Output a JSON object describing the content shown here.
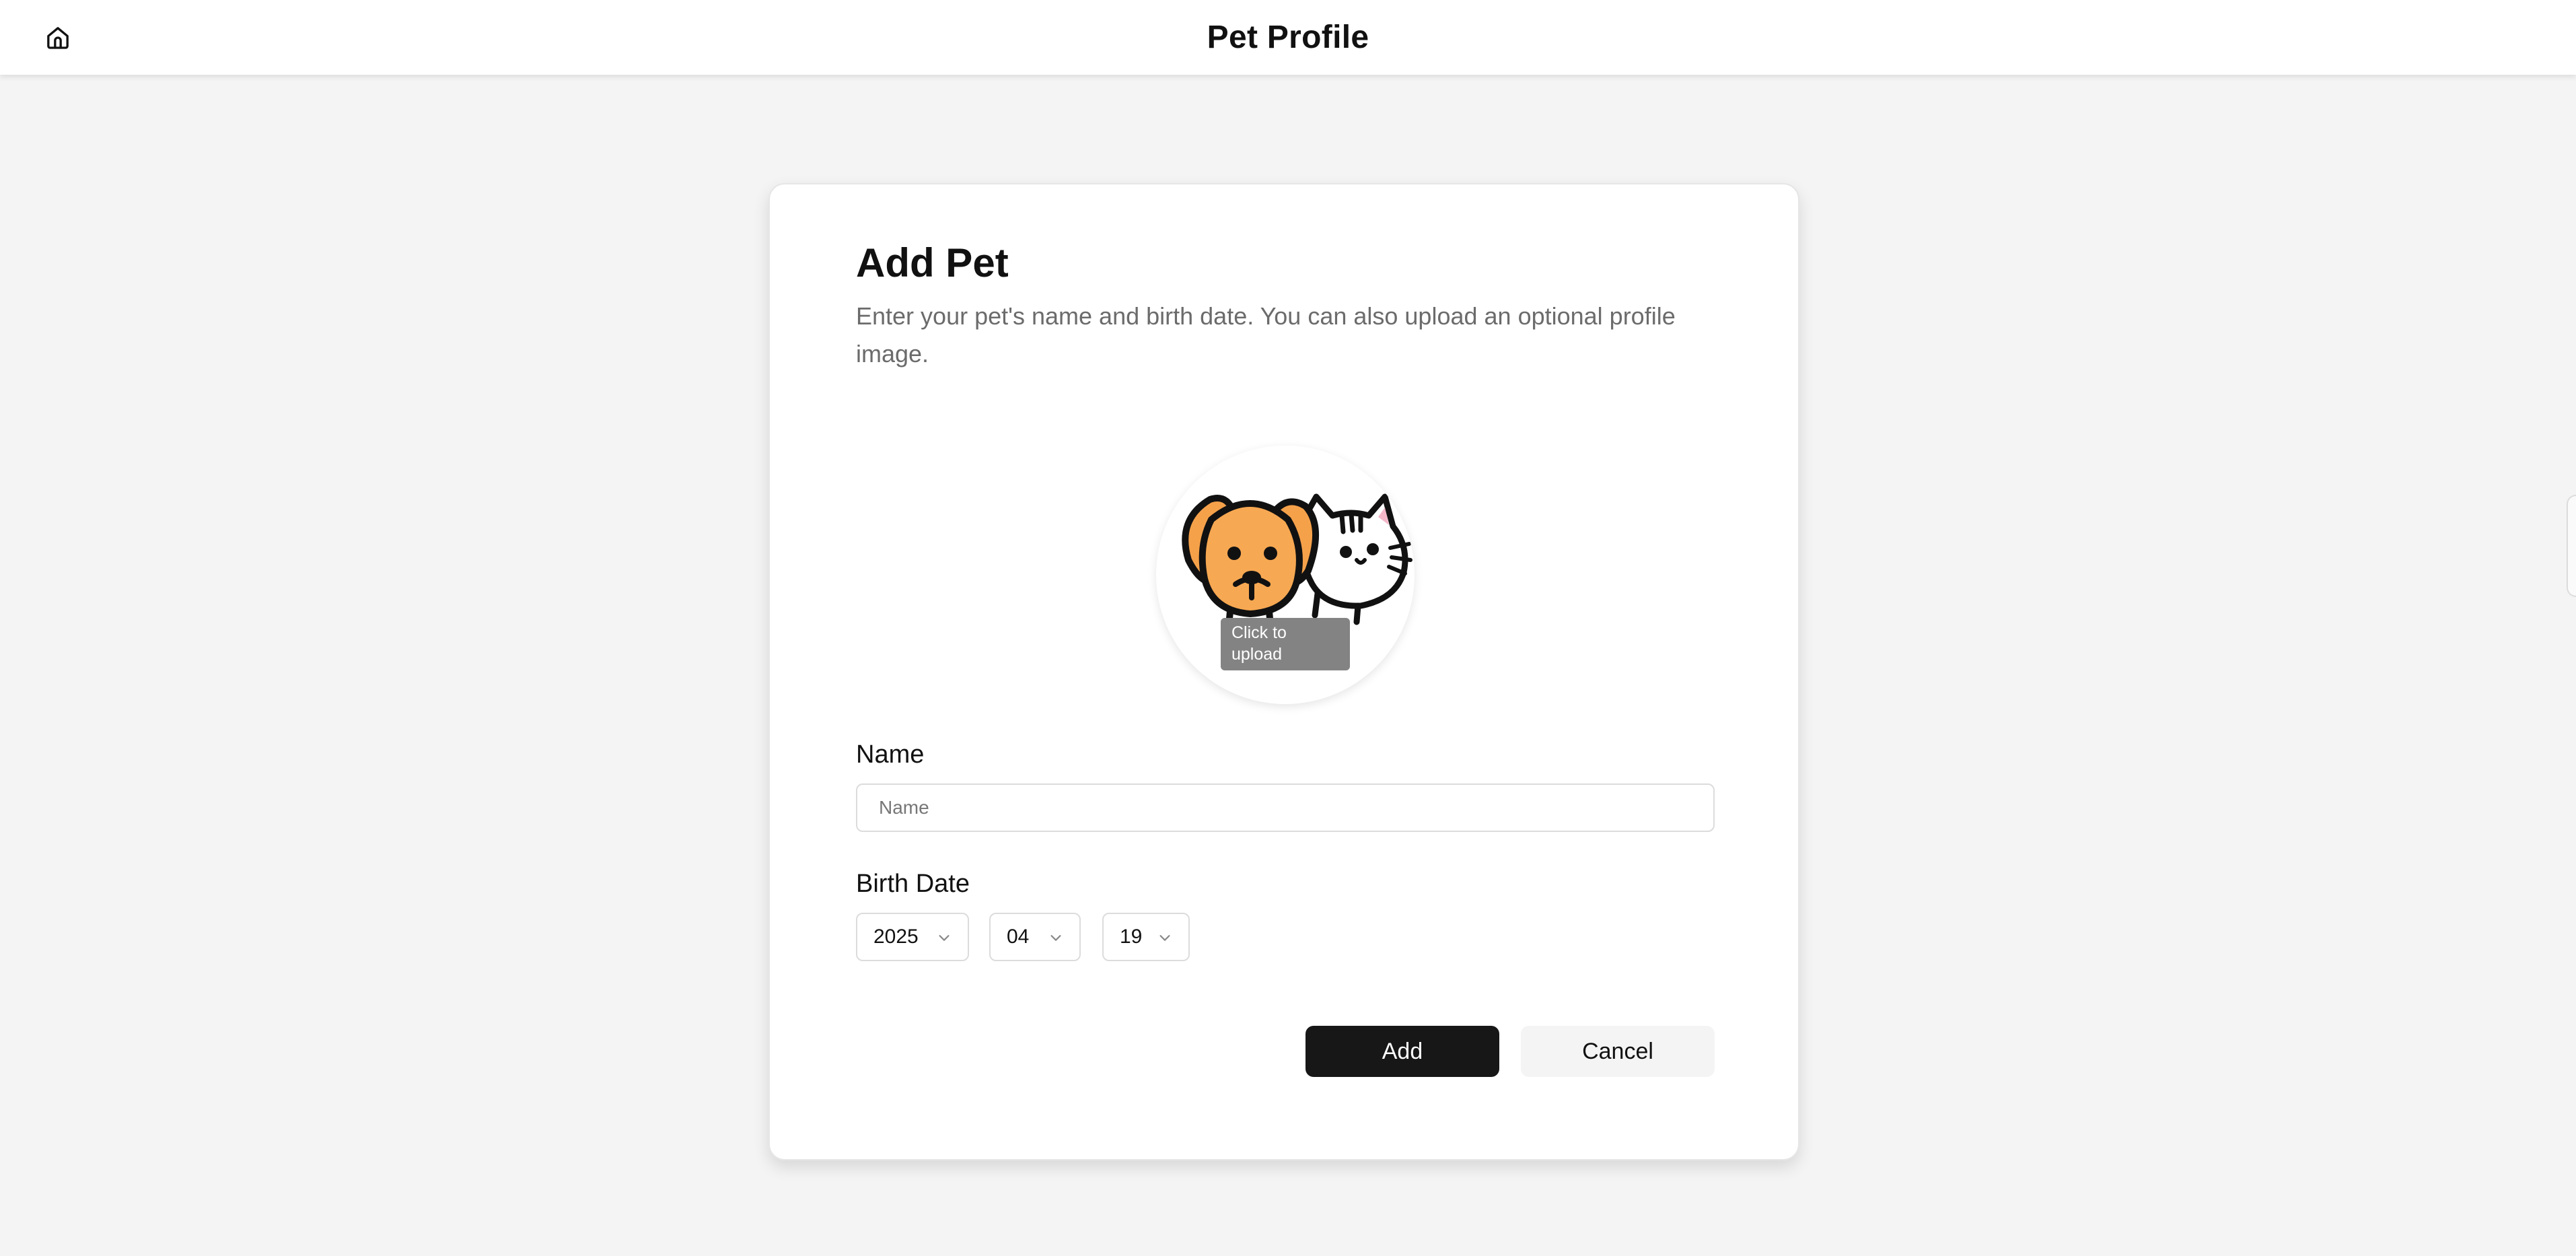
{
  "header": {
    "title": "Pet Profile",
    "home_icon": "home-icon"
  },
  "form": {
    "title": "Add Pet",
    "description": "Enter your pet's name and birth date. You can also upload an optional profile image.",
    "avatar": {
      "image": "dog-and-cat-illustration",
      "upload_hint": "Click to upload"
    },
    "name": {
      "label": "Name",
      "placeholder": "Name",
      "value": ""
    },
    "birth_date": {
      "label": "Birth Date",
      "year": "2025",
      "month": "04",
      "day": "19"
    },
    "add_label": "Add",
    "cancel_label": "Cancel"
  },
  "colors": {
    "primary_button": "#171717",
    "secondary_button": "#f4f4f4",
    "page_background": "#f4f4f4",
    "dog_fur": "#f5a14a"
  }
}
